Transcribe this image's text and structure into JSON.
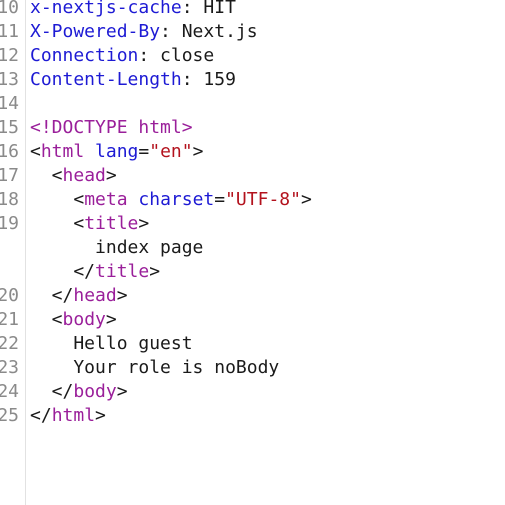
{
  "lines": [
    {
      "num": "10",
      "tokens": [
        {
          "t": "x-nextjs-cache",
          "c": "kw"
        },
        {
          "t": ": HIT",
          "c": "pl"
        }
      ]
    },
    {
      "num": "11",
      "tokens": [
        {
          "t": "X-Powered-By",
          "c": "kw"
        },
        {
          "t": ": Next.js",
          "c": "pl"
        }
      ]
    },
    {
      "num": "12",
      "tokens": [
        {
          "t": "Connection",
          "c": "kw"
        },
        {
          "t": ": close",
          "c": "pl"
        }
      ]
    },
    {
      "num": "13",
      "tokens": [
        {
          "t": "Content-Length",
          "c": "kw"
        },
        {
          "t": ": 159",
          "c": "pl"
        }
      ]
    },
    {
      "num": "14",
      "tokens": []
    },
    {
      "num": "15",
      "tokens": [
        {
          "t": "<!DOCTYPE html>",
          "c": "tag"
        }
      ]
    },
    {
      "num": "16",
      "tokens": [
        {
          "t": "<",
          "c": "pl"
        },
        {
          "t": "html",
          "c": "tag"
        },
        {
          "t": " ",
          "c": "pl"
        },
        {
          "t": "lang",
          "c": "attr"
        },
        {
          "t": "=",
          "c": "pl"
        },
        {
          "t": "\"en\"",
          "c": "str"
        },
        {
          "t": ">",
          "c": "pl"
        }
      ]
    },
    {
      "num": "17",
      "tokens": [
        {
          "t": "  <",
          "c": "pl"
        },
        {
          "t": "head",
          "c": "tag"
        },
        {
          "t": ">",
          "c": "pl"
        }
      ]
    },
    {
      "num": "18",
      "tokens": [
        {
          "t": "    <",
          "c": "pl"
        },
        {
          "t": "meta",
          "c": "tag"
        },
        {
          "t": " ",
          "c": "pl"
        },
        {
          "t": "charset",
          "c": "attr"
        },
        {
          "t": "=",
          "c": "pl"
        },
        {
          "t": "\"UTF-8\"",
          "c": "str"
        },
        {
          "t": ">",
          "c": "pl"
        }
      ]
    },
    {
      "num": "19",
      "tokens": [
        {
          "t": "    <",
          "c": "pl"
        },
        {
          "t": "title",
          "c": "tag"
        },
        {
          "t": ">",
          "c": "pl"
        }
      ]
    },
    {
      "num": "",
      "tokens": [
        {
          "t": "      index page",
          "c": "pl"
        }
      ]
    },
    {
      "num": "",
      "tokens": [
        {
          "t": "    </",
          "c": "pl"
        },
        {
          "t": "title",
          "c": "tag"
        },
        {
          "t": ">",
          "c": "pl"
        }
      ]
    },
    {
      "num": "20",
      "tokens": [
        {
          "t": "  </",
          "c": "pl"
        },
        {
          "t": "head",
          "c": "tag"
        },
        {
          "t": ">",
          "c": "pl"
        }
      ]
    },
    {
      "num": "21",
      "tokens": [
        {
          "t": "  <",
          "c": "pl"
        },
        {
          "t": "body",
          "c": "tag"
        },
        {
          "t": ">",
          "c": "pl"
        }
      ]
    },
    {
      "num": "22",
      "tokens": [
        {
          "t": "    Hello guest",
          "c": "pl"
        }
      ]
    },
    {
      "num": "23",
      "tokens": [
        {
          "t": "    Your role is noBody",
          "c": "pl"
        }
      ]
    },
    {
      "num": "24",
      "tokens": [
        {
          "t": "  </",
          "c": "pl"
        },
        {
          "t": "body",
          "c": "tag"
        },
        {
          "t": ">",
          "c": "pl"
        }
      ]
    },
    {
      "num": "25",
      "tokens": [
        {
          "t": "</",
          "c": "pl"
        },
        {
          "t": "html",
          "c": "tag"
        },
        {
          "t": ">",
          "c": "pl"
        }
      ]
    }
  ]
}
